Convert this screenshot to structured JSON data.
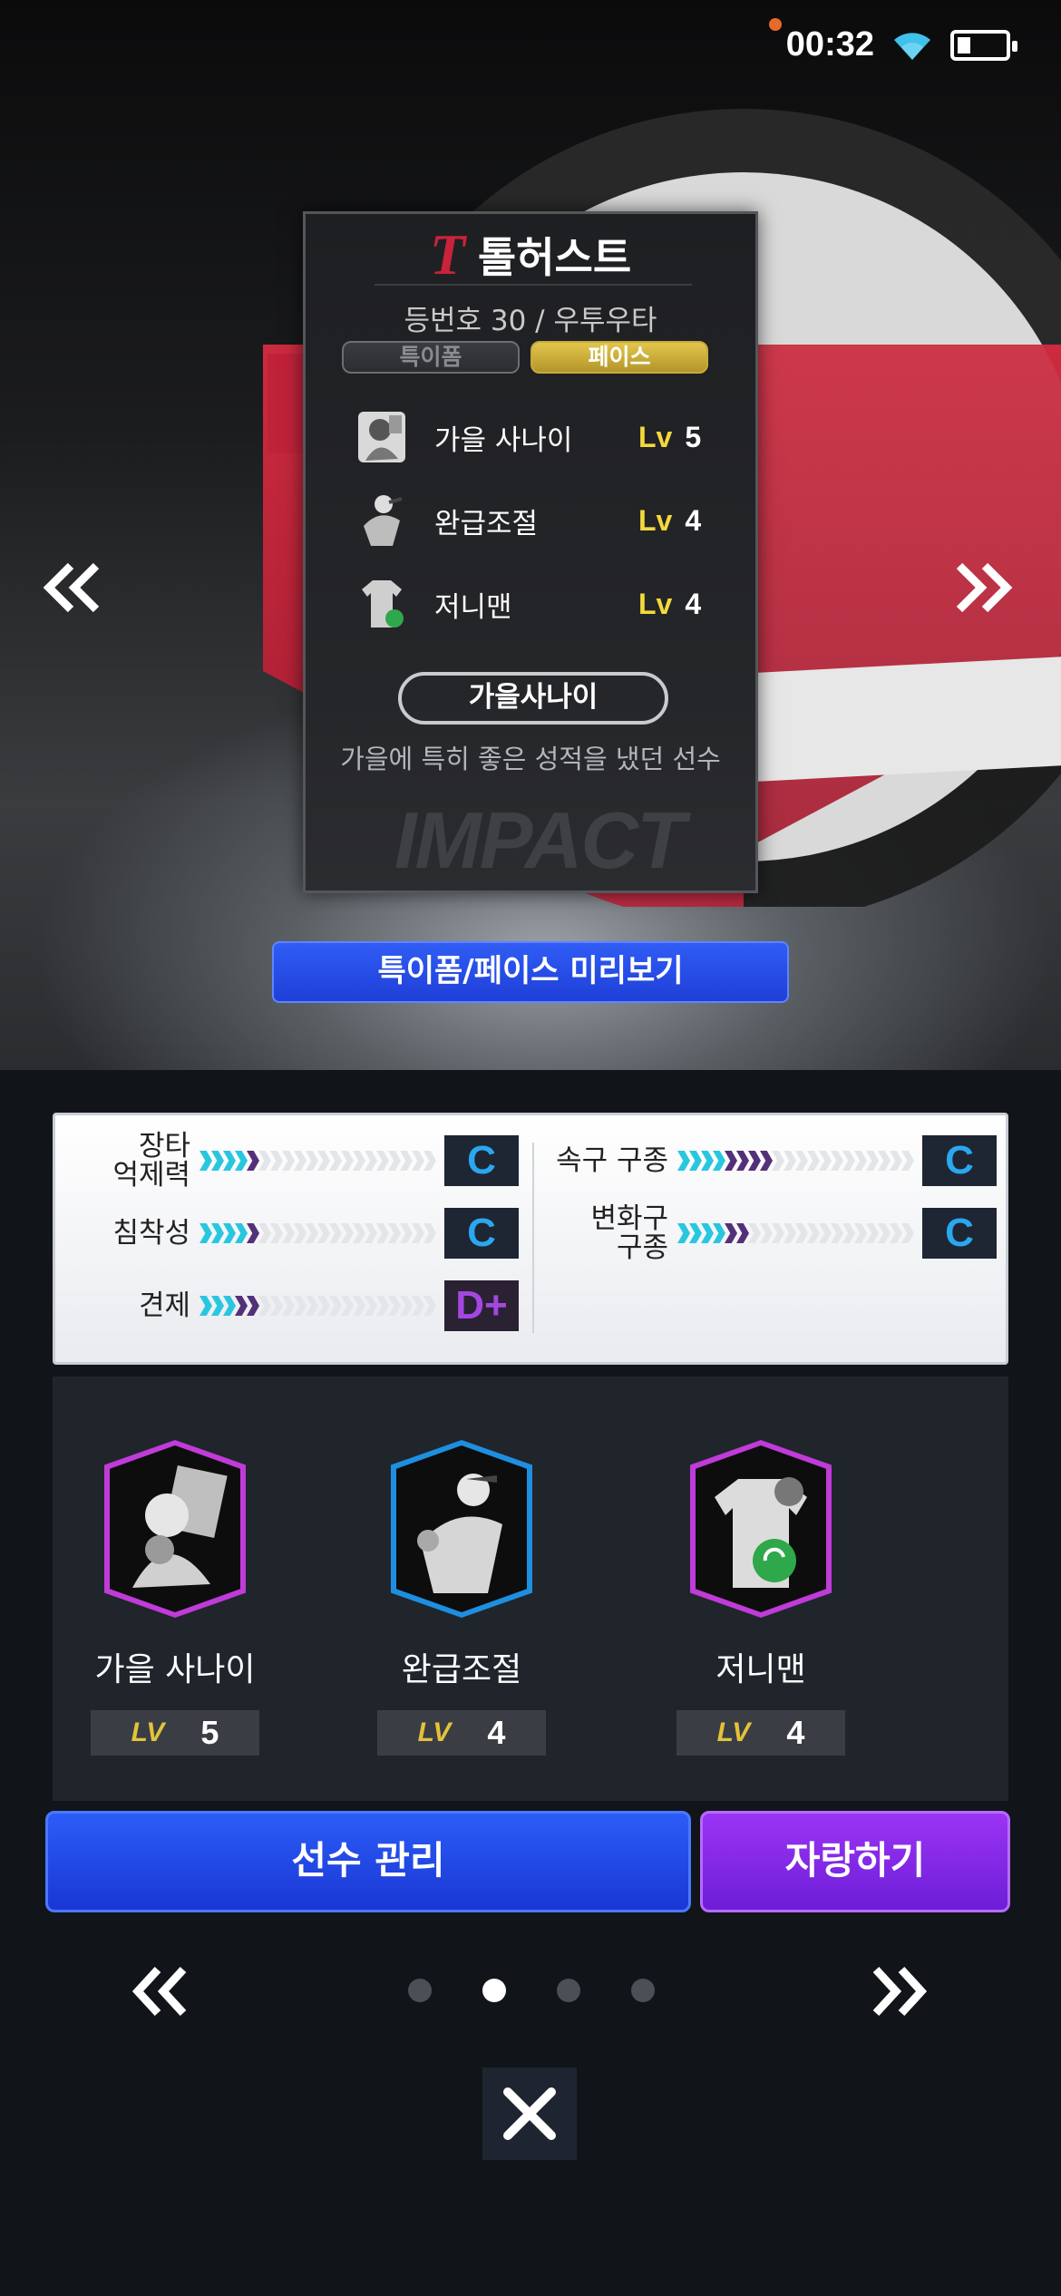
{
  "status_bar": {
    "time": "00:32"
  },
  "card": {
    "team_logo": "T",
    "player_name": "톨허스트",
    "player_info": "등번호 30 / 우투우타",
    "tabs": [
      {
        "label": "특이폼",
        "active": false
      },
      {
        "label": "페이스",
        "active": true
      }
    ],
    "skills": [
      {
        "name": "가을 사나이",
        "lv_label": "Lv",
        "lv": "5",
        "icon": "autumn-man-icon"
      },
      {
        "name": "완급조절",
        "lv_label": "Lv",
        "lv": "4",
        "icon": "pitcher-icon"
      },
      {
        "name": "저니맨",
        "lv_label": "Lv",
        "lv": "4",
        "icon": "journeyman-icon"
      }
    ],
    "selected_face": "가을사나이",
    "selected_face_desc": "가을에 특히 좋은 성적을 냈던 선수",
    "watermark": "IMPACT"
  },
  "preview_button": "특이폼/페이스 미리보기",
  "stats": {
    "left": [
      {
        "label_line1": "장타",
        "label_line2": "억제력",
        "cyan": 4,
        "purple": 1,
        "grade": "C"
      },
      {
        "label_line1": "침착성",
        "label_line2": "",
        "cyan": 4,
        "purple": 1,
        "grade": "C"
      },
      {
        "label_line1": "견제",
        "label_line2": "",
        "cyan": 3,
        "purple": 2,
        "grade": "D+"
      }
    ],
    "right": [
      {
        "label_line1": "속구 구종",
        "label_line2": "",
        "cyan": 4,
        "purple": 4,
        "grade": "C"
      },
      {
        "label_line1": "변화구",
        "label_line2": "구종",
        "cyan": 4,
        "purple": 2,
        "grade": "C"
      }
    ]
  },
  "faces": [
    {
      "name": "가을 사나이",
      "lv_label": "LV",
      "lv": "5",
      "border": "#c03bd8",
      "icon": "autumn-man-icon"
    },
    {
      "name": "완급조절",
      "lv_label": "LV",
      "lv": "4",
      "border": "#1e8fe0",
      "icon": "pitcher-icon"
    },
    {
      "name": "저니맨",
      "lv_label": "LV",
      "lv": "4",
      "border": "#c03bd8",
      "icon": "journeyman-icon"
    }
  ],
  "buttons": {
    "manage": "선수 관리",
    "boast": "자랑하기"
  },
  "pager": {
    "total": 4,
    "active": 1
  },
  "colors": {
    "accent_blue": "#2b5cf7",
    "accent_purple": "#9b34f5",
    "lv_gold": "#e4c23a",
    "grade_blue": "#2aa7f0",
    "grade_purple": "#a447e0"
  }
}
